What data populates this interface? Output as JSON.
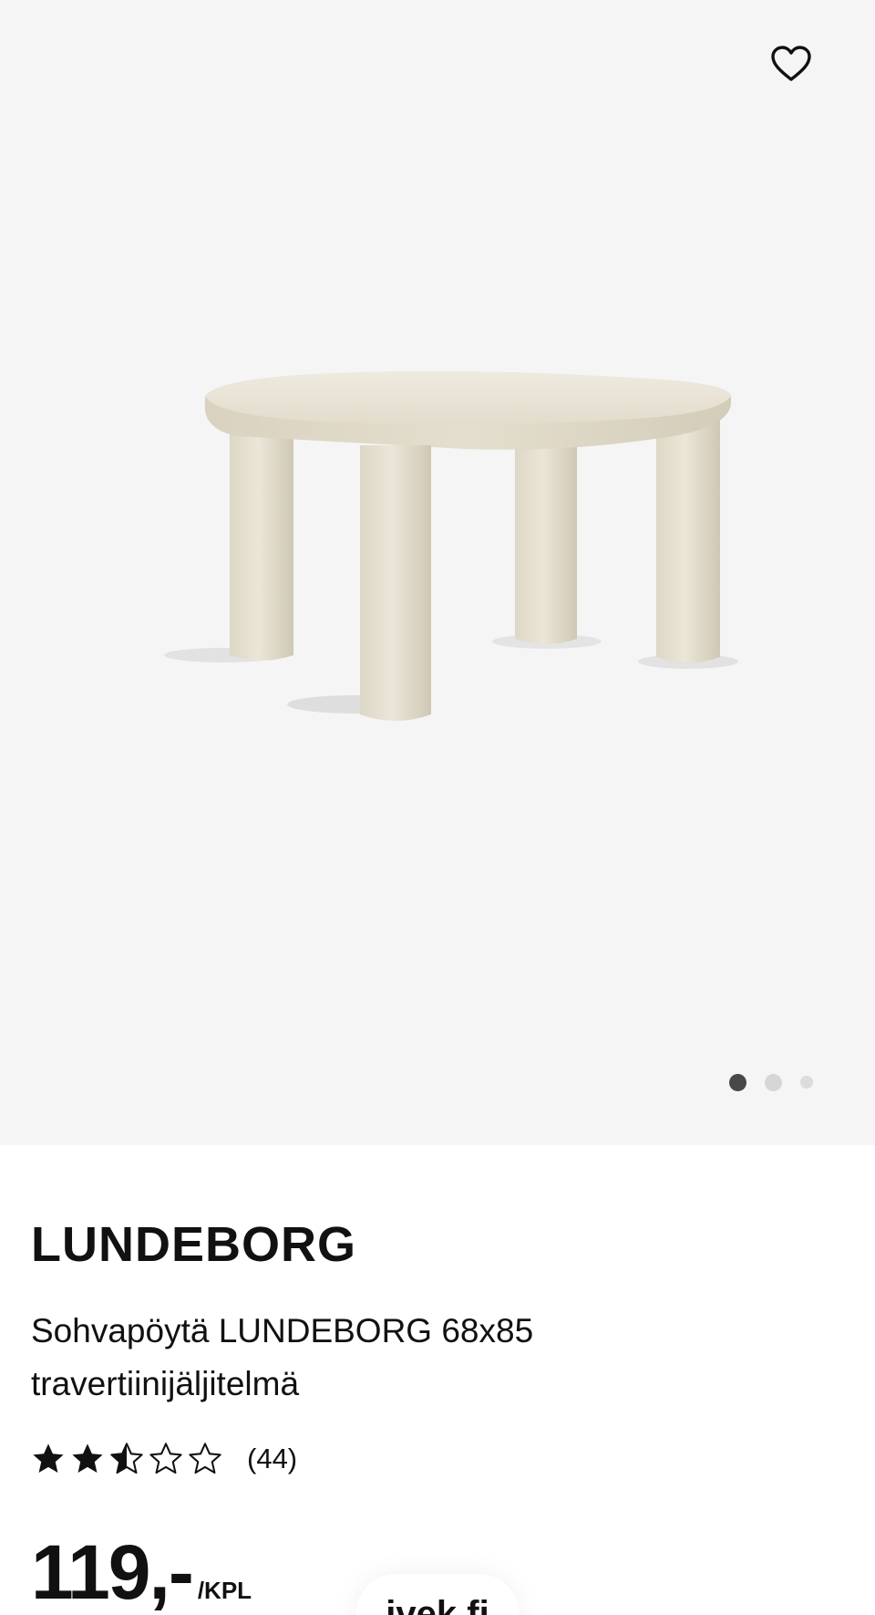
{
  "gallery": {
    "favorite_icon": "heart-outline-icon",
    "image_alt": "LUNDEBORG",
    "slide_count": 3,
    "active_slide": 1
  },
  "product": {
    "name": "LUNDEBORG",
    "description_line1": "Sohvapöytä LUNDEBORG 68x85",
    "description_line2": "travertiinijäljitelmä",
    "rating": 2.5,
    "rating_max": 5,
    "review_count": "(44)",
    "price": "119,-",
    "price_unit": "/KPL"
  },
  "overlay": {
    "site_label": "ivek.fi"
  },
  "colors": {
    "gallery_bg": "#f5f5f5",
    "text": "#111111",
    "dot_active": "#484848",
    "dot_inactive": "#d6d6d6"
  }
}
